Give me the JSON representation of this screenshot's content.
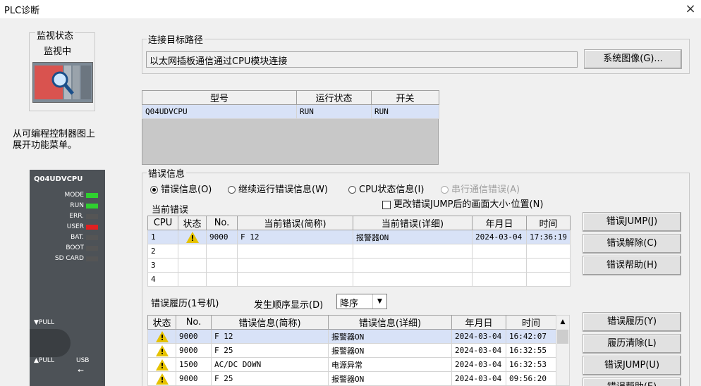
{
  "window": {
    "title": "PLC诊断",
    "close": "×"
  },
  "monitor": {
    "legend": "监视状态",
    "status": "监视中"
  },
  "hint": "从可编程控制器图上\n展开功能菜单。",
  "plc_panel": {
    "model": "Q04UDVCPU",
    "leds": [
      {
        "label": "MODE",
        "color": "#2fd02f"
      },
      {
        "label": "RUN",
        "color": "#2fd02f"
      },
      {
        "label": "ERR.",
        "color": "#555555"
      },
      {
        "label": "USER",
        "color": "#e02020"
      },
      {
        "label": "BAT.",
        "color": "#555555"
      },
      {
        "label": "BOOT",
        "color": "#555555"
      },
      {
        "label": "SD CARD",
        "color": "#555555"
      }
    ],
    "pull1": "▼PULL",
    "pull2": "▲PULL",
    "usb": "USB"
  },
  "connection": {
    "legend": "连接目标路径",
    "path": "以太网插板通信通过CPU模块连接",
    "system_image_button": "系统图像(G)..."
  },
  "cpu_table": {
    "headers": [
      "型号",
      "运行状态",
      "开关"
    ],
    "rows": [
      [
        "Q04UDVCPU",
        "RUN",
        "RUN"
      ]
    ]
  },
  "error_info": {
    "legend": "错误信息",
    "radios": [
      {
        "label": "错误信息(O)",
        "checked": true,
        "disabled": false
      },
      {
        "label": "继续运行错误信息(W)",
        "checked": false,
        "disabled": false
      },
      {
        "label": "CPU状态信息(I)",
        "checked": false,
        "disabled": false
      },
      {
        "label": "串行通信错误(A)",
        "checked": false,
        "disabled": true
      }
    ],
    "checkbox_label": "更改错误JUMP后的画面大小·位置(N)",
    "current_label": "当前错误",
    "current_headers": [
      "CPU",
      "状态",
      "No.",
      "当前错误(简称)",
      "当前错误(详细)",
      "年月日",
      "时间"
    ],
    "current_rows": [
      {
        "cpu": "1",
        "warn": true,
        "no": "9000",
        "short": "F 12",
        "detail": "报警器ON",
        "date": "2024-03-04",
        "time": "17:36:19"
      },
      {
        "cpu": "2",
        "warn": false,
        "no": "",
        "short": "",
        "detail": "",
        "date": "",
        "time": ""
      },
      {
        "cpu": "3",
        "warn": false,
        "no": "",
        "short": "",
        "detail": "",
        "date": "",
        "time": ""
      },
      {
        "cpu": "4",
        "warn": false,
        "no": "",
        "short": "",
        "detail": "",
        "date": "",
        "time": ""
      }
    ],
    "buttons": [
      "错误JUMP(J)",
      "错误解除(C)",
      "错误帮助(H)"
    ]
  },
  "history": {
    "label": "错误履历(1号机)",
    "order_label": "发生顺序显示(D)",
    "order_value": "降序",
    "headers": [
      "状态",
      "No.",
      "错误信息(简称)",
      "错误信息(详细)",
      "年月日",
      "时间"
    ],
    "rows": [
      {
        "no": "9000",
        "short": "F 12",
        "detail": "报警器ON",
        "date": "2024-03-04",
        "time": "16:42:07"
      },
      {
        "no": "9000",
        "short": "F 25",
        "detail": "报警器ON",
        "date": "2024-03-04",
        "time": "16:32:55"
      },
      {
        "no": "1500",
        "short": "AC/DC DOWN",
        "detail": "电源异常",
        "date": "2024-03-04",
        "time": "16:32:53"
      },
      {
        "no": "9000",
        "short": "F 25",
        "detail": "报警器ON",
        "date": "2024-03-04",
        "time": "09:56:20"
      }
    ],
    "buttons": [
      "错误履历(Y)",
      "履历清除(L)",
      "错误JUMP(U)",
      "错误帮助(E)"
    ]
  }
}
